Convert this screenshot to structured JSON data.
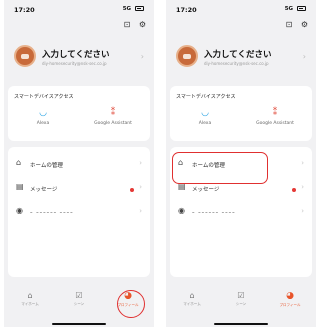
{
  "screens": [
    {
      "status": {
        "time": "17:20",
        "signal": "5G"
      },
      "profile": {
        "name": "入力してください",
        "email": "diy-homesecurity@nsk-sec.co.jp"
      },
      "access": {
        "title": "スマートデバイスアクセス",
        "items": [
          {
            "label": "Alexa"
          },
          {
            "label": "Google Assistant"
          }
        ]
      },
      "menu": [
        {
          "label": "ホームの管理"
        },
        {
          "label": "メッセージ"
        },
        {
          "label": "ｰ ｰｰｰｰｰｰ ｰｰｰｰ"
        }
      ],
      "tabs": [
        {
          "label": "マイホーム"
        },
        {
          "label": "シーン"
        },
        {
          "label": "プロフィール"
        }
      ]
    },
    {
      "status": {
        "time": "17:20",
        "signal": "5G"
      },
      "profile": {
        "name": "入力してください",
        "email": "diy-homesecurity@nsk-sec.co.jp"
      },
      "access": {
        "title": "スマートデバイスアクセス",
        "items": [
          {
            "label": "Alexa"
          },
          {
            "label": "Google Assistant"
          }
        ]
      },
      "menu": [
        {
          "label": "ホームの管理"
        },
        {
          "label": "メッセージ"
        },
        {
          "label": "ｰ ｰｰｰｰｰｰ ｰｰｰｰ"
        }
      ],
      "tabs": [
        {
          "label": "マイホーム"
        },
        {
          "label": "シーン"
        },
        {
          "label": "プロフィール"
        }
      ]
    }
  ],
  "colors": {
    "accent": "#e8542a",
    "highlight": "#e03030",
    "alexa": "#1a9de2",
    "google": "#e04a3b"
  }
}
